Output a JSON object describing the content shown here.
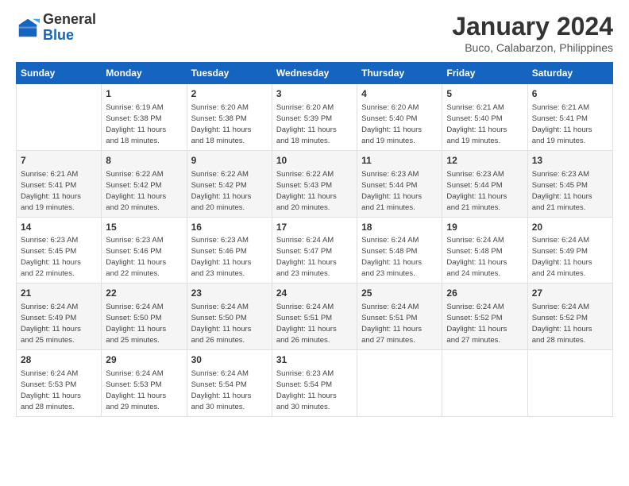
{
  "logo": {
    "line1": "General",
    "line2": "Blue"
  },
  "title": "January 2024",
  "subtitle": "Buco, Calabarzon, Philippines",
  "days_of_week": [
    "Sunday",
    "Monday",
    "Tuesday",
    "Wednesday",
    "Thursday",
    "Friday",
    "Saturday"
  ],
  "weeks": [
    [
      {
        "day": "",
        "info": ""
      },
      {
        "day": "1",
        "info": "Sunrise: 6:19 AM\nSunset: 5:38 PM\nDaylight: 11 hours\nand 18 minutes."
      },
      {
        "day": "2",
        "info": "Sunrise: 6:20 AM\nSunset: 5:38 PM\nDaylight: 11 hours\nand 18 minutes."
      },
      {
        "day": "3",
        "info": "Sunrise: 6:20 AM\nSunset: 5:39 PM\nDaylight: 11 hours\nand 18 minutes."
      },
      {
        "day": "4",
        "info": "Sunrise: 6:20 AM\nSunset: 5:40 PM\nDaylight: 11 hours\nand 19 minutes."
      },
      {
        "day": "5",
        "info": "Sunrise: 6:21 AM\nSunset: 5:40 PM\nDaylight: 11 hours\nand 19 minutes."
      },
      {
        "day": "6",
        "info": "Sunrise: 6:21 AM\nSunset: 5:41 PM\nDaylight: 11 hours\nand 19 minutes."
      }
    ],
    [
      {
        "day": "7",
        "info": "Sunrise: 6:21 AM\nSunset: 5:41 PM\nDaylight: 11 hours\nand 19 minutes."
      },
      {
        "day": "8",
        "info": "Sunrise: 6:22 AM\nSunset: 5:42 PM\nDaylight: 11 hours\nand 20 minutes."
      },
      {
        "day": "9",
        "info": "Sunrise: 6:22 AM\nSunset: 5:42 PM\nDaylight: 11 hours\nand 20 minutes."
      },
      {
        "day": "10",
        "info": "Sunrise: 6:22 AM\nSunset: 5:43 PM\nDaylight: 11 hours\nand 20 minutes."
      },
      {
        "day": "11",
        "info": "Sunrise: 6:23 AM\nSunset: 5:44 PM\nDaylight: 11 hours\nand 21 minutes."
      },
      {
        "day": "12",
        "info": "Sunrise: 6:23 AM\nSunset: 5:44 PM\nDaylight: 11 hours\nand 21 minutes."
      },
      {
        "day": "13",
        "info": "Sunrise: 6:23 AM\nSunset: 5:45 PM\nDaylight: 11 hours\nand 21 minutes."
      }
    ],
    [
      {
        "day": "14",
        "info": "Sunrise: 6:23 AM\nSunset: 5:45 PM\nDaylight: 11 hours\nand 22 minutes."
      },
      {
        "day": "15",
        "info": "Sunrise: 6:23 AM\nSunset: 5:46 PM\nDaylight: 11 hours\nand 22 minutes."
      },
      {
        "day": "16",
        "info": "Sunrise: 6:23 AM\nSunset: 5:46 PM\nDaylight: 11 hours\nand 23 minutes."
      },
      {
        "day": "17",
        "info": "Sunrise: 6:24 AM\nSunset: 5:47 PM\nDaylight: 11 hours\nand 23 minutes."
      },
      {
        "day": "18",
        "info": "Sunrise: 6:24 AM\nSunset: 5:48 PM\nDaylight: 11 hours\nand 23 minutes."
      },
      {
        "day": "19",
        "info": "Sunrise: 6:24 AM\nSunset: 5:48 PM\nDaylight: 11 hours\nand 24 minutes."
      },
      {
        "day": "20",
        "info": "Sunrise: 6:24 AM\nSunset: 5:49 PM\nDaylight: 11 hours\nand 24 minutes."
      }
    ],
    [
      {
        "day": "21",
        "info": "Sunrise: 6:24 AM\nSunset: 5:49 PM\nDaylight: 11 hours\nand 25 minutes."
      },
      {
        "day": "22",
        "info": "Sunrise: 6:24 AM\nSunset: 5:50 PM\nDaylight: 11 hours\nand 25 minutes."
      },
      {
        "day": "23",
        "info": "Sunrise: 6:24 AM\nSunset: 5:50 PM\nDaylight: 11 hours\nand 26 minutes."
      },
      {
        "day": "24",
        "info": "Sunrise: 6:24 AM\nSunset: 5:51 PM\nDaylight: 11 hours\nand 26 minutes."
      },
      {
        "day": "25",
        "info": "Sunrise: 6:24 AM\nSunset: 5:51 PM\nDaylight: 11 hours\nand 27 minutes."
      },
      {
        "day": "26",
        "info": "Sunrise: 6:24 AM\nSunset: 5:52 PM\nDaylight: 11 hours\nand 27 minutes."
      },
      {
        "day": "27",
        "info": "Sunrise: 6:24 AM\nSunset: 5:52 PM\nDaylight: 11 hours\nand 28 minutes."
      }
    ],
    [
      {
        "day": "28",
        "info": "Sunrise: 6:24 AM\nSunset: 5:53 PM\nDaylight: 11 hours\nand 28 minutes."
      },
      {
        "day": "29",
        "info": "Sunrise: 6:24 AM\nSunset: 5:53 PM\nDaylight: 11 hours\nand 29 minutes."
      },
      {
        "day": "30",
        "info": "Sunrise: 6:24 AM\nSunset: 5:54 PM\nDaylight: 11 hours\nand 30 minutes."
      },
      {
        "day": "31",
        "info": "Sunrise: 6:23 AM\nSunset: 5:54 PM\nDaylight: 11 hours\nand 30 minutes."
      },
      {
        "day": "",
        "info": ""
      },
      {
        "day": "",
        "info": ""
      },
      {
        "day": "",
        "info": ""
      }
    ]
  ]
}
